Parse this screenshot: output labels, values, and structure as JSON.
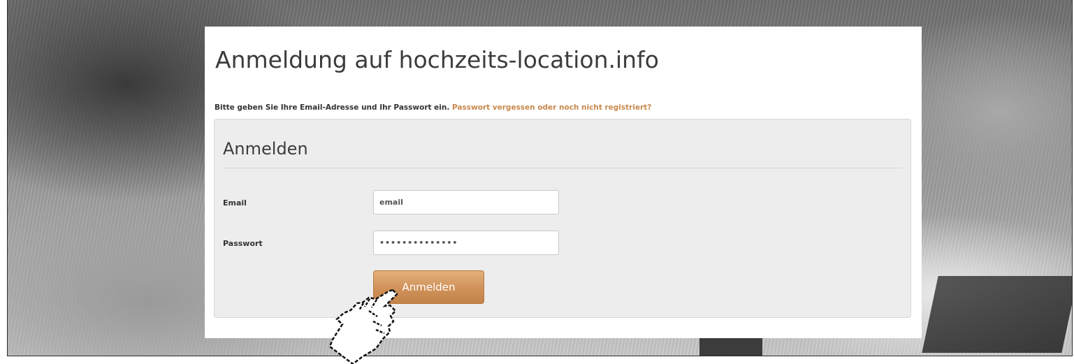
{
  "page": {
    "title": "Anmeldung auf hochzeits-location.info",
    "intro_text": "Bitte geben Sie Ihre Email-Adresse und Ihr Passwort ein.",
    "forgot_link": "Passwort vergessen oder noch nicht registriert?"
  },
  "form": {
    "legend": "Anmelden",
    "email": {
      "label": "Email",
      "value": "email"
    },
    "password": {
      "label": "Passwort",
      "value": "••••••••••••••"
    },
    "submit_label": "Anmelden"
  },
  "colors": {
    "accent": "#c8894d",
    "button_top": "#e3b07c",
    "button_bottom": "#c3834a",
    "panel_background": "#ecedec",
    "title_text": "#3c3c3c"
  },
  "icons": {
    "cursor": "pointing-hand-icon"
  }
}
